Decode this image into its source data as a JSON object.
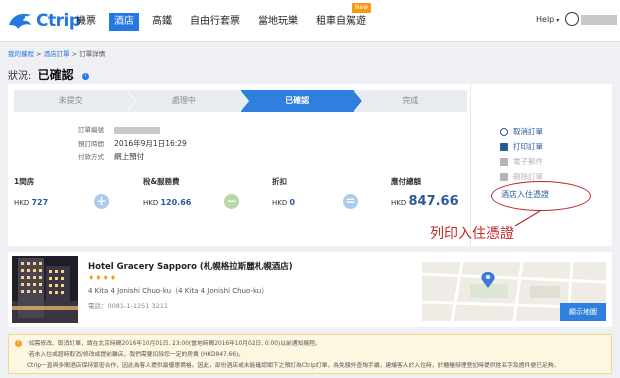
{
  "header": {
    "logo_text": "Ctrip",
    "nav": [
      {
        "label": "機票",
        "active": false
      },
      {
        "label": "酒店",
        "active": true
      },
      {
        "label": "高鐵",
        "active": false
      },
      {
        "label": "自由行套票",
        "active": false
      },
      {
        "label": "當地玩樂",
        "active": false
      },
      {
        "label": "租車自駕遊",
        "active": false,
        "badge": "New"
      }
    ],
    "help_label": "Help"
  },
  "breadcrumb": {
    "items": [
      "我的攜程",
      "酒店訂單",
      "訂單詳情"
    ],
    "separator": ">"
  },
  "status": {
    "label": "狀況:",
    "value": "已確認"
  },
  "steps": [
    {
      "label": "未提交",
      "active": false
    },
    {
      "label": "處理中",
      "active": false
    },
    {
      "label": "已確認",
      "active": true
    },
    {
      "label": "完成",
      "active": false
    }
  ],
  "order_details": {
    "order_no_label": "訂單編號",
    "booking_time_label": "預訂時間",
    "booking_time_value": "2016年9月1日16:29",
    "payment_label": "付款方式",
    "payment_value": "網上預付"
  },
  "summary": {
    "rooms_label": "1間房",
    "rooms_currency": "HKD",
    "rooms_value": "727",
    "tax_label": "稅&服務費",
    "tax_currency": "HKD",
    "tax_value": "120.66",
    "discount_label": "折扣",
    "discount_currency": "HKD",
    "discount_value": "0",
    "total_label": "應付總額",
    "total_currency": "HKD",
    "total_value": "847.66",
    "op_plus": "+",
    "op_minus": "−",
    "op_eq": "="
  },
  "actions": {
    "cancel": "取消訂單",
    "print": "打印訂單",
    "email": "電子郵件",
    "delete": "刪除訂單",
    "voucher": "酒店入住憑證"
  },
  "annotation": {
    "text": "列印入住憑證"
  },
  "hotel": {
    "name": "Hotel Gracery Sapporo (札幌格拉斯麗札幌酒店)",
    "stars": "♦♦♦♦",
    "address": "4 Kita 4 Jonishi Chuo-ku（4 Kita 4 Jonishi Chuo-ku）",
    "phone_label": "電話：",
    "phone": "0081-1-1251 3211",
    "map_button": "顯示地圖"
  },
  "notice": {
    "lines": [
      "·如需修改、取消訂單，請在北京時間2016年10月01日, 23:00(當地時間2016年10月02日, 0:00)以前通知攜程。",
      "·若未入住或超時取消/修改或提前離店，我們需要扣除您一定的房費 (HKD847.66)。",
      "Ctrip一直與多間酒店保持緊密合作，因此為客人提供最優惠價格。因此，部份酒店或未能確認閣下之預訂為Ctrip訂單，為免額外查詢手續，建議客人於入住時，於櫃檯辦理登記時提供姓名字及證件便已足夠。"
    ]
  },
  "colors": {
    "brand": "#2577e3",
    "step_active": "#2f7fde",
    "annotation": "#c0282d",
    "price": "#2a5a9a"
  }
}
